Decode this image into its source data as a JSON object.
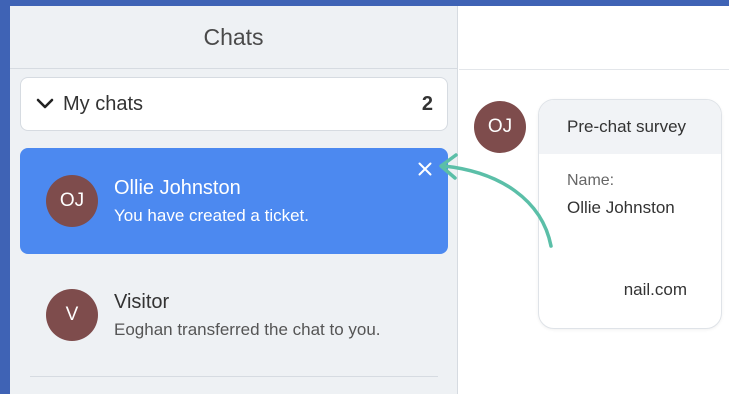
{
  "header": {
    "title": "Chats"
  },
  "my_chats": {
    "label": "My chats",
    "count": "2",
    "icon": "chevron-down-icon"
  },
  "chats": [
    {
      "initials": "OJ",
      "name": "Ollie Johnston",
      "message": "You have created a ticket.",
      "active": true,
      "close_icon": "close-icon"
    },
    {
      "initials": "V",
      "name": "Visitor",
      "message": "Eoghan transferred the chat to you.",
      "active": false
    }
  ],
  "conversation": {
    "avatar_initials": "OJ",
    "survey": {
      "title": "Pre-chat survey",
      "name_label": "Name:",
      "name_value": "Ollie Johnston",
      "email_value_partial": "nail.com"
    }
  },
  "colors": {
    "frame_border": "#3f63b5",
    "active_item": "#4c89f0",
    "avatar": "#7e4c4c",
    "arrow": "#5bbfa8",
    "panel_bg": "#eef1f4"
  }
}
